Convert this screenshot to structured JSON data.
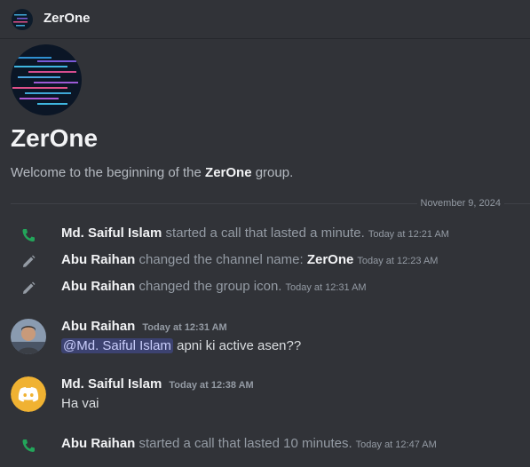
{
  "header": {
    "title": "ZerOne",
    "avatar_icon": "group-avatar-icon"
  },
  "intro": {
    "title": "ZerOne",
    "welcome_prefix": "Welcome to the beginning of the ",
    "welcome_group": "ZerOne",
    "welcome_suffix": " group."
  },
  "date_divider": "November 9, 2024",
  "system_messages": [
    {
      "icon": "phone-icon",
      "user": "Md. Saiful Islam",
      "text": " started a call that lasted a minute.",
      "time": "Today at 12:21 AM"
    },
    {
      "icon": "pencil-icon",
      "user": "Abu Raihan",
      "text": " changed the channel name: ",
      "strong": "ZerOne",
      "time": "Today at 12:23 AM"
    },
    {
      "icon": "pencil-icon",
      "user": "Abu Raihan",
      "text": " changed the group icon.",
      "time": "Today at 12:31 AM"
    }
  ],
  "messages": [
    {
      "author": "Abu Raihan",
      "time": "Today at 12:31 AM",
      "mention": "@Md. Saiful Islam",
      "text": " apni ki active asen??"
    },
    {
      "author": "Md. Saiful Islam",
      "time": "Today at 12:38 AM",
      "text": "Ha vai"
    }
  ],
  "last_system_message": {
    "icon": "phone-icon",
    "user": "Abu Raihan",
    "text": " started a call that lasted 10 minutes.",
    "time": "Today at 12:47 AM"
  },
  "colors": {
    "background": "#313338",
    "call_green": "#23a55a",
    "discord_avatar_orange": "#f0b232",
    "mention_bg": "#3c4270"
  }
}
